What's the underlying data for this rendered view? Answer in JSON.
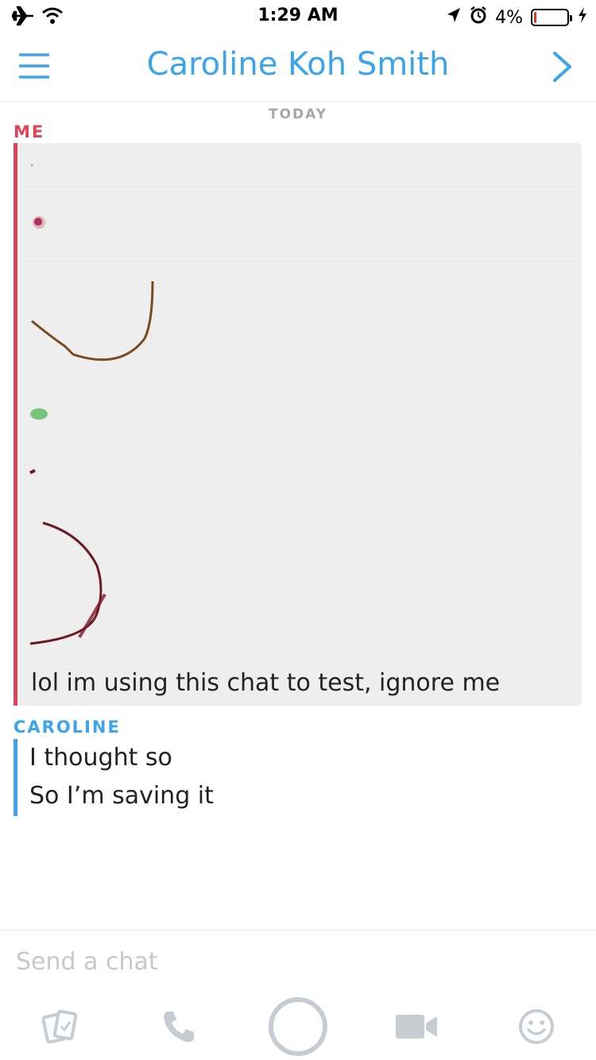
{
  "status_bar": {
    "time": "1:29 AM",
    "battery_percent": "4%",
    "battery_level": 0.04,
    "icons": [
      "airplane-icon",
      "wifi-icon",
      "location-arrow-icon",
      "alarm-icon",
      "battery-icon",
      "charging-bolt-icon"
    ]
  },
  "header": {
    "title": "Caroline Koh Smith",
    "menu_icon": "hamburger-menu-icon",
    "next_icon": "chevron-right-icon"
  },
  "chat": {
    "date_divider": "TODAY",
    "groups": [
      {
        "sender": "ME",
        "color": "#e04357",
        "drawings": [
          "drawing-dot",
          "drawing-small-circle",
          "drawing-smile-curve",
          "drawing-green-dot",
          "drawing-arc"
        ],
        "messages": [
          "lol im using this chat to test, ignore me"
        ]
      },
      {
        "sender": "CAROLINE",
        "color": "#3ba4ea",
        "messages": [
          "I thought so",
          "So I’m saving it"
        ]
      }
    ]
  },
  "composer": {
    "placeholder": "Send a chat"
  },
  "toolbar": {
    "items": [
      "memories-cards-icon",
      "phone-icon",
      "capture-circle-icon",
      "video-camera-icon",
      "emoji-smile-icon"
    ]
  },
  "colors": {
    "accent_blue": "#3ba4ea",
    "me_red": "#e04357",
    "bubble_gray": "#eeeeee",
    "icon_gray": "#c7ccd3"
  }
}
